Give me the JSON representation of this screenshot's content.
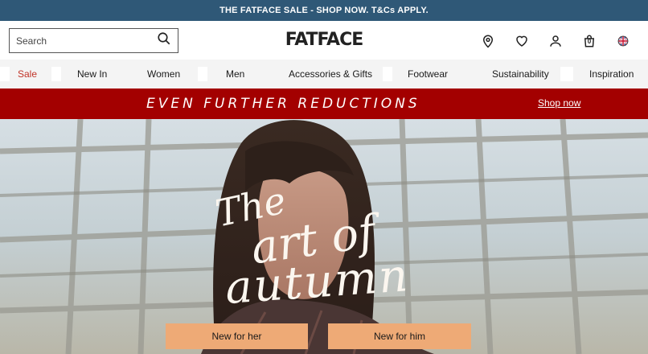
{
  "topbar": {
    "text": "THE FATFACE SALE - SHOP NOW. T&Cs APPLY."
  },
  "header": {
    "search_placeholder": "Search",
    "logo": "FATFACE",
    "icons": [
      "location-pin-icon",
      "heart-icon",
      "account-icon",
      "bag-icon",
      "uk-flag-icon"
    ],
    "bag_count": "0"
  },
  "nav": {
    "items": [
      {
        "label": "Sale"
      },
      {
        "label": "New In"
      },
      {
        "label": "Women"
      },
      {
        "label": "Men"
      },
      {
        "label": "Accessories & Gifts"
      },
      {
        "label": "Footwear"
      },
      {
        "label": "Sustainability"
      },
      {
        "label": "Inspiration"
      }
    ]
  },
  "promo": {
    "text": "EVEN FURTHER REDUCTIONS",
    "link": "Shop now"
  },
  "hero": {
    "headline_line1": "The",
    "headline_line2": "art of",
    "headline_line3": "autumn",
    "cta_her": "New for her",
    "cta_him": "New for him"
  },
  "colors": {
    "topbar": "#2f5877",
    "promo": "#a30000",
    "cta": "#eeaa76",
    "sale": "#c13327"
  }
}
